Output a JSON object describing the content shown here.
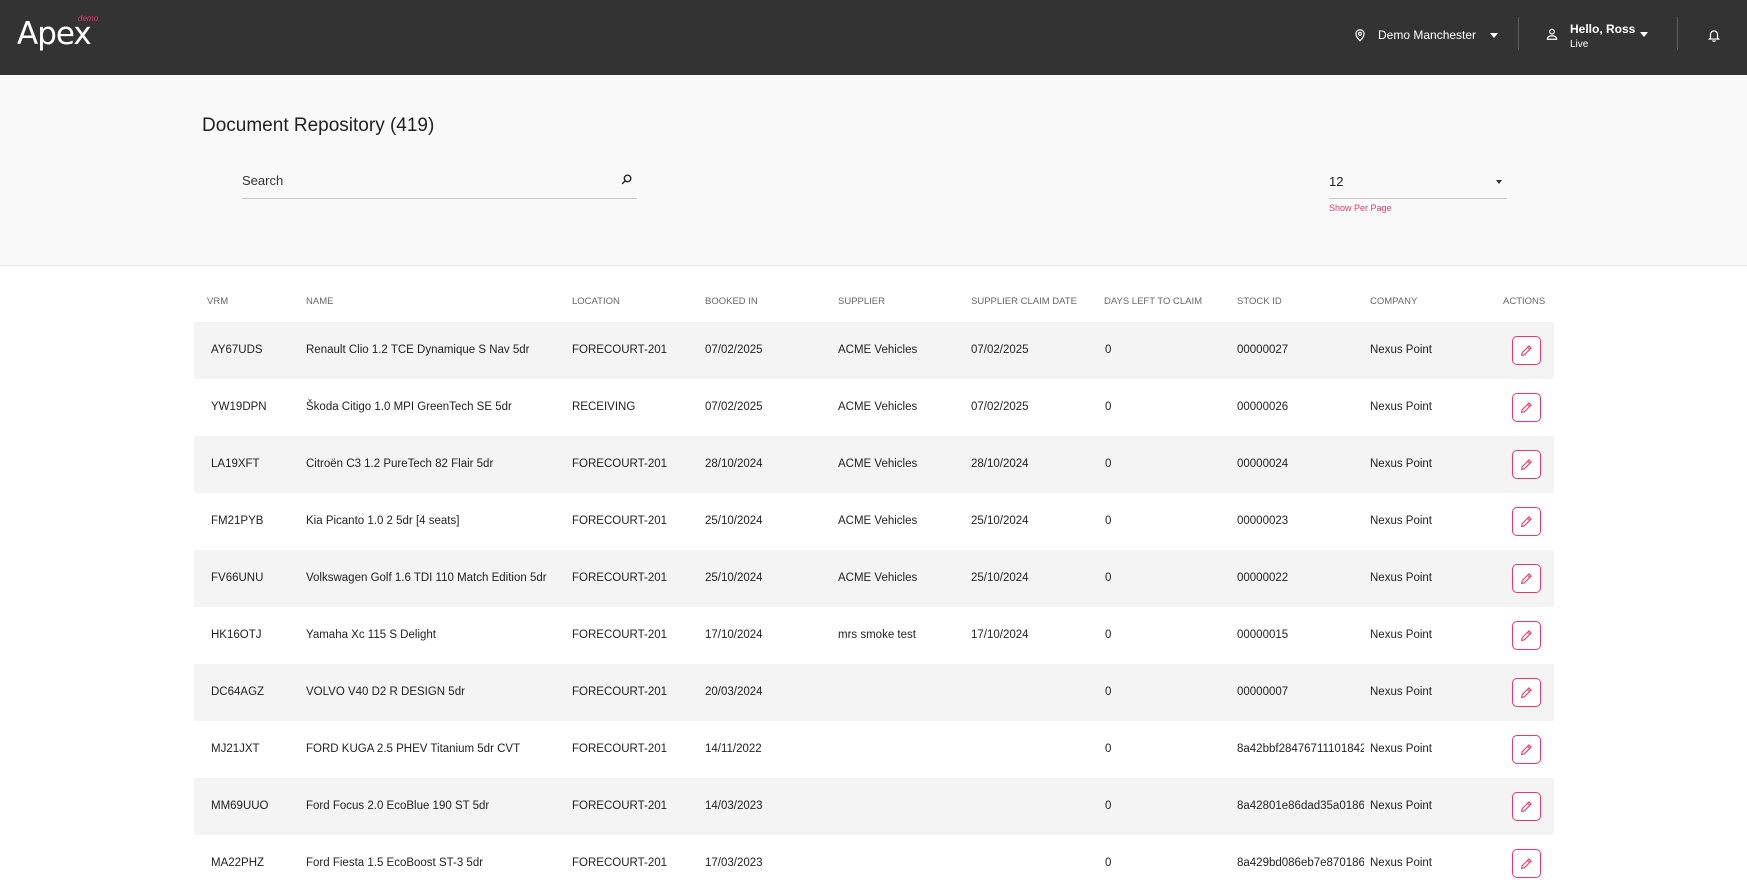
{
  "app": {
    "logo_text": "Apex",
    "logo_badge": "demo"
  },
  "topbar": {
    "location": "Demo Manchester",
    "user_greeting": "Hello, Ross",
    "user_status": "Live"
  },
  "page": {
    "title": "Document Repository (419)"
  },
  "search": {
    "placeholder": "Search",
    "value": ""
  },
  "per_page": {
    "value": "12",
    "hint": "Show Per Page"
  },
  "table": {
    "columns": [
      "VRM",
      "NAME",
      "LOCATION",
      "BOOKED IN",
      "SUPPLIER",
      "SUPPLIER CLAIM DATE",
      "DAYS LEFT TO CLAIM",
      "STOCK ID",
      "COMPANY",
      "ACTIONS"
    ],
    "rows": [
      {
        "vrm": "AY67UDS",
        "name": "Renault Clio 1.2 TCE Dynamique S Nav 5dr",
        "location": "FORECOURT-201",
        "booked_in": "07/02/2025",
        "supplier": "ACME Vehicles",
        "claim_date": "07/02/2025",
        "days_left": "0",
        "stock_id": "00000027",
        "company": "Nexus Point"
      },
      {
        "vrm": "YW19DPN",
        "name": "Škoda Citigo 1.0 MPI GreenTech SE 5dr",
        "location": "RECEIVING",
        "booked_in": "07/02/2025",
        "supplier": "ACME Vehicles",
        "claim_date": "07/02/2025",
        "days_left": "0",
        "stock_id": "00000026",
        "company": "Nexus Point"
      },
      {
        "vrm": "LA19XFT",
        "name": "Citroën C3 1.2 PureTech 82 Flair 5dr",
        "location": "FORECOURT-201",
        "booked_in": "28/10/2024",
        "supplier": "ACME Vehicles",
        "claim_date": "28/10/2024",
        "days_left": "0",
        "stock_id": "00000024",
        "company": "Nexus Point"
      },
      {
        "vrm": "FM21PYB",
        "name": "Kia Picanto 1.0 2 5dr [4 seats]",
        "location": "FORECOURT-201",
        "booked_in": "25/10/2024",
        "supplier": "ACME Vehicles",
        "claim_date": "25/10/2024",
        "days_left": "0",
        "stock_id": "00000023",
        "company": "Nexus Point"
      },
      {
        "vrm": "FV66UNU",
        "name": "Volkswagen Golf 1.6 TDI 110 Match Edition 5dr",
        "location": "FORECOURT-201",
        "booked_in": "25/10/2024",
        "supplier": "ACME Vehicles",
        "claim_date": "25/10/2024",
        "days_left": "0",
        "stock_id": "00000022",
        "company": "Nexus Point"
      },
      {
        "vrm": "HK16OTJ",
        "name": "Yamaha Xc 115 S Delight",
        "location": "FORECOURT-201",
        "booked_in": "17/10/2024",
        "supplier": "mrs smoke test",
        "claim_date": "17/10/2024",
        "days_left": "0",
        "stock_id": "00000015",
        "company": "Nexus Point"
      },
      {
        "vrm": "DC64AGZ",
        "name": "VOLVO V40 D2 R DESIGN 5dr",
        "location": "FORECOURT-201",
        "booked_in": "20/03/2024",
        "supplier": "",
        "claim_date": "",
        "days_left": "0",
        "stock_id": "00000007",
        "company": "Nexus Point"
      },
      {
        "vrm": "MJ21JXT",
        "name": "FORD KUGA 2.5 PHEV Titanium 5dr CVT",
        "location": "FORECOURT-201",
        "booked_in": "14/11/2022",
        "supplier": "",
        "claim_date": "",
        "days_left": "0",
        "stock_id": "8a42bbf28476711101842",
        "company": "Nexus Point"
      },
      {
        "vrm": "MM69UUO",
        "name": "Ford Focus 2.0 EcoBlue 190 ST 5dr",
        "location": "FORECOURT-201",
        "booked_in": "14/03/2023",
        "supplier": "",
        "claim_date": "",
        "days_left": "0",
        "stock_id": "8a42801e86dad35a0186",
        "company": "Nexus Point"
      },
      {
        "vrm": "MA22PHZ",
        "name": "Ford Fiesta 1.5 EcoBoost ST-3 5dr",
        "location": "FORECOURT-201",
        "booked_in": "17/03/2023",
        "supplier": "",
        "claim_date": "",
        "days_left": "0",
        "stock_id": "8a429bd086eb7e870186",
        "company": "Nexus Point"
      }
    ]
  },
  "colors": {
    "topbar": "#333333",
    "accent": "#e8396e",
    "row_alt": "#f4f4f4"
  },
  "icons": {
    "location": "map-pin-icon",
    "user": "user-icon",
    "notifications": "bell-icon",
    "search": "search-icon",
    "row_action": "edit-pencil-icon"
  }
}
